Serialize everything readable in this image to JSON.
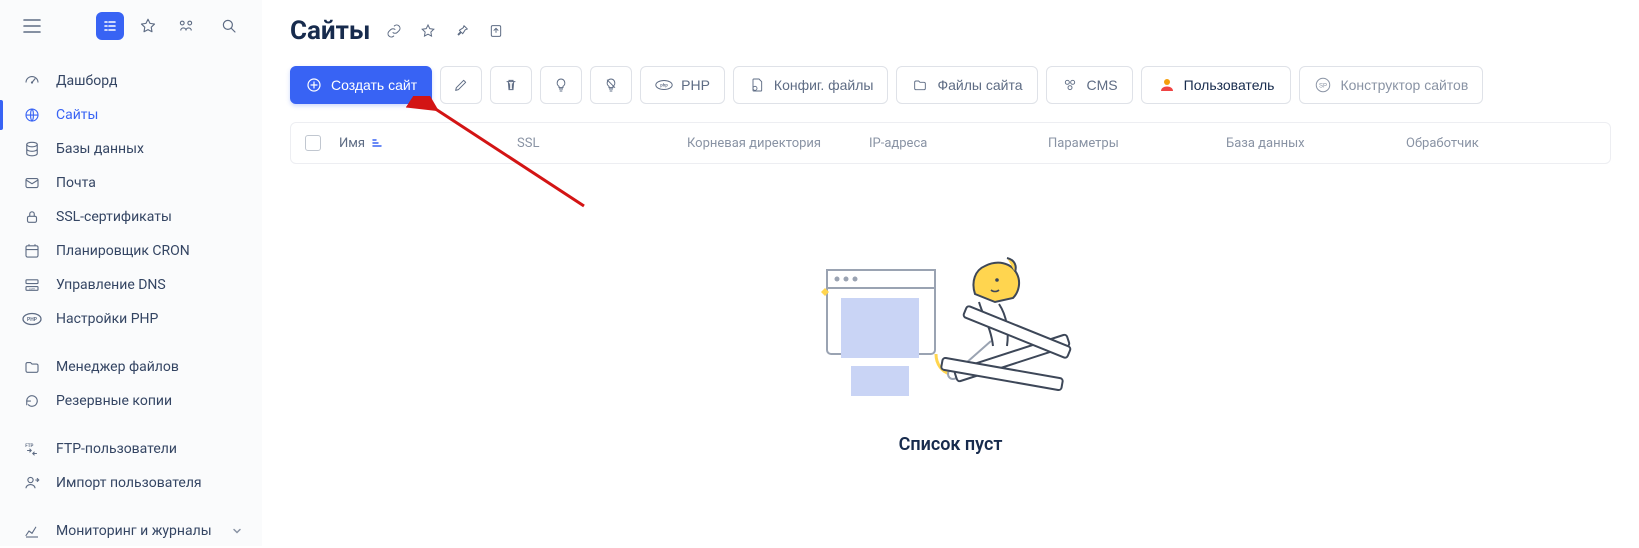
{
  "page": {
    "title": "Сайты"
  },
  "sidebar": {
    "items": [
      {
        "label": "Дашборд"
      },
      {
        "label": "Сайты"
      },
      {
        "label": "Базы данных"
      },
      {
        "label": "Почта"
      },
      {
        "label": "SSL-сертификаты"
      },
      {
        "label": "Планировщик CRON"
      },
      {
        "label": "Управление DNS"
      },
      {
        "label": "Настройки PHP"
      },
      {
        "label": "Менеджер файлов"
      },
      {
        "label": "Резервные копии"
      },
      {
        "label": "FTP-пользователи"
      },
      {
        "label": "Импорт пользователя"
      },
      {
        "label": "Мониторинг и журналы"
      }
    ]
  },
  "toolbar": {
    "create": "Создать сайт",
    "php": "PHP",
    "config": "Конфиг. файлы",
    "files": "Файлы сайта",
    "cms": "CMS",
    "user": "Пользователь",
    "builder": "Конструктор сайтов"
  },
  "table": {
    "cols": {
      "name": "Имя",
      "ssl": "SSL",
      "root": "Корневая директория",
      "ip": "IP-адреса",
      "params": "Параметры",
      "db": "База данных",
      "handler": "Обработчик"
    }
  },
  "empty": {
    "text": "Список пуст"
  }
}
